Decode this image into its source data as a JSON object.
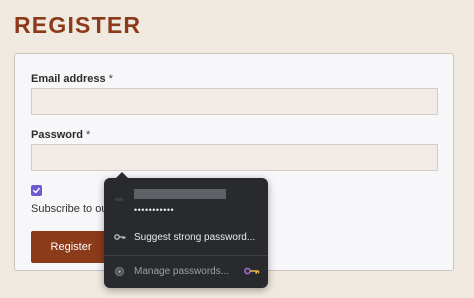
{
  "page": {
    "title": "REGISTER"
  },
  "form": {
    "email_label": "Email address",
    "email_required": "*",
    "password_label": "Password",
    "password_required": "*",
    "subscribe_label": "Subscribe to our",
    "register_button": "Register",
    "subscribe_checked": true
  },
  "autofill_popup": {
    "saved_password_mask": "•••••••••••",
    "suggest_label": "Suggest strong password...",
    "manage_label": "Manage passwords...",
    "icons": {
      "suggest": "key-icon",
      "manage": "chrome-logo-icon",
      "extension": "password-manager-key-icon"
    }
  },
  "colors": {
    "brand": "#8b3a1a",
    "checkbox": "#6b5bd4",
    "popup_bg": "#292a2d"
  }
}
